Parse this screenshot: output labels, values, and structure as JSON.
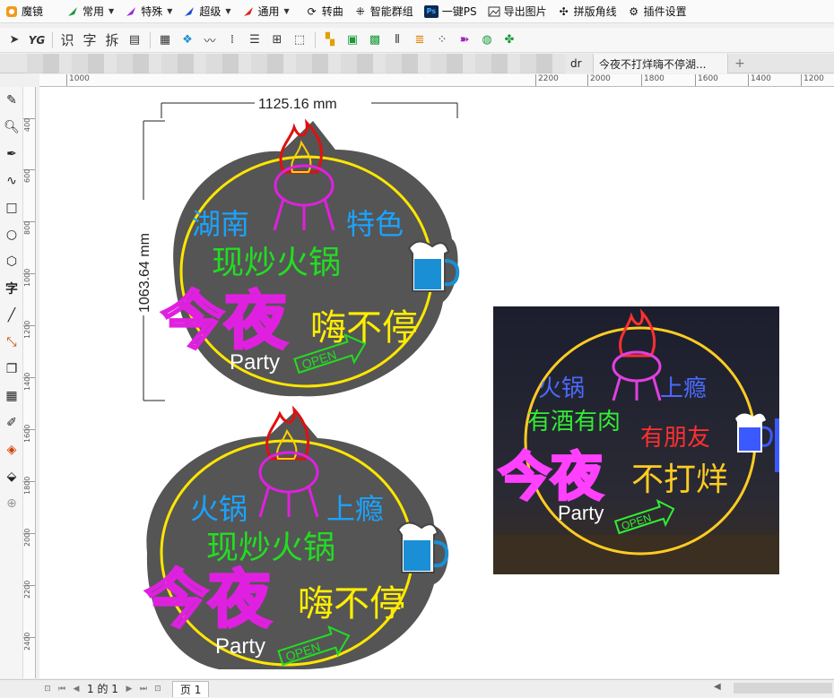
{
  "menubar": {
    "items": [
      {
        "label": "魔镜",
        "icon": "mojing-logo-icon"
      },
      {
        "label": "常用",
        "icon": "green-arrow-icon"
      },
      {
        "label": "特殊",
        "icon": "purple-arrow-icon"
      },
      {
        "label": "超级",
        "icon": "blue-arrow-icon"
      },
      {
        "label": "通用",
        "icon": "red-arrow-icon"
      },
      {
        "label": "转曲",
        "icon": "refresh-icon"
      },
      {
        "label": "智能群组",
        "icon": "group-icon"
      },
      {
        "label": "一键PS",
        "icon": "photoshop-icon",
        "badge": "Ps"
      },
      {
        "label": "导出图片",
        "icon": "image-icon"
      },
      {
        "label": "拼版角线",
        "icon": "crop-marks-icon"
      },
      {
        "label": "插件设置",
        "icon": "gear-icon"
      }
    ]
  },
  "toolbar": {
    "text_buttons": [
      "识",
      "字",
      "拆"
    ],
    "yg_label": "YG"
  },
  "tabs": {
    "partial_tab": "dr",
    "active_tab": "今夜不打烊嗨不停湖...",
    "add": "+"
  },
  "ruler_top": [
    "1000",
    "2200",
    "2000",
    "1800",
    "1600",
    "1400",
    "1200"
  ],
  "ruler_left": [
    "400",
    "600",
    "800",
    "1000",
    "1200",
    "1400",
    "1600",
    "1800",
    "2000",
    "2200",
    "2400"
  ],
  "design": {
    "width_dim": "1125.16 mm",
    "height_dim": "1063.64 mm",
    "sign1": {
      "line1_left": "湖南",
      "line1_right": "特色",
      "line2": "现炒火锅",
      "big": "今夜",
      "side": "嗨不停",
      "party": "Party",
      "open": "OPEN"
    },
    "sign2": {
      "line1_left": "火锅",
      "line1_right": "上瘾",
      "line2": "现炒火锅",
      "big": "今夜",
      "side": "嗨不停",
      "party": "Party",
      "open": "OPEN"
    },
    "photo": {
      "line1_left": "火锅",
      "line1_right": "上瘾",
      "line2": "有酒有肉",
      "line2_right": "有朋友",
      "big": "今夜",
      "side": "不打烊",
      "party": "Party",
      "open": "OPEN"
    }
  },
  "status": {
    "page_counter": "1 的 1",
    "page_tab": "页 1"
  },
  "colors": {
    "sign_bg": "#555555",
    "ring": "#ffe600",
    "neon_blue": "#1aa3ff",
    "neon_green": "#22dd22",
    "neon_pink": "#e020e0",
    "neon_yellow": "#ffee00",
    "flame_red": "#e01010"
  }
}
